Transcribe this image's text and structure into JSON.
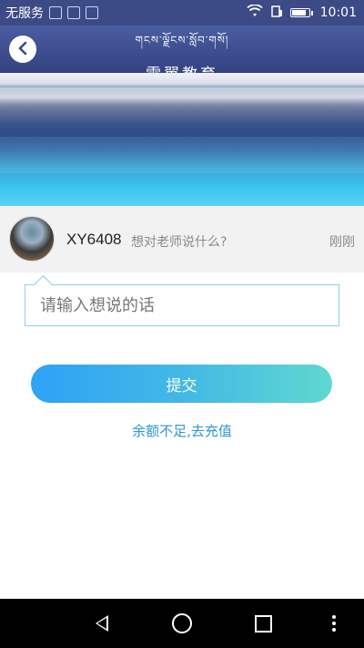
{
  "status_bar": {
    "carrier": "无服务",
    "time": "10:01",
    "icons": [
      "notification-icon",
      "image-icon",
      "notification-icon",
      "wifi-icon",
      "sim-icon",
      "battery-icon"
    ]
  },
  "header": {
    "title_tibetan": "གངས་ལྗོངས་སློབ་གསོ།",
    "title": "雪翼教育",
    "back_icon": "chevron-left-icon"
  },
  "message": {
    "username": "XY6408",
    "prompt": "想对老师说什么?",
    "time": "刚刚"
  },
  "form": {
    "placeholder": "请输入想说的话",
    "submit_label": "提交",
    "recharge_link": "余额不足,去充值"
  },
  "colors": {
    "header": "#3c4a86",
    "button_start": "#2ea2f5",
    "button_end": "#5fd8d0",
    "link": "#2f96d6",
    "input_border": "#8fd1e6"
  }
}
